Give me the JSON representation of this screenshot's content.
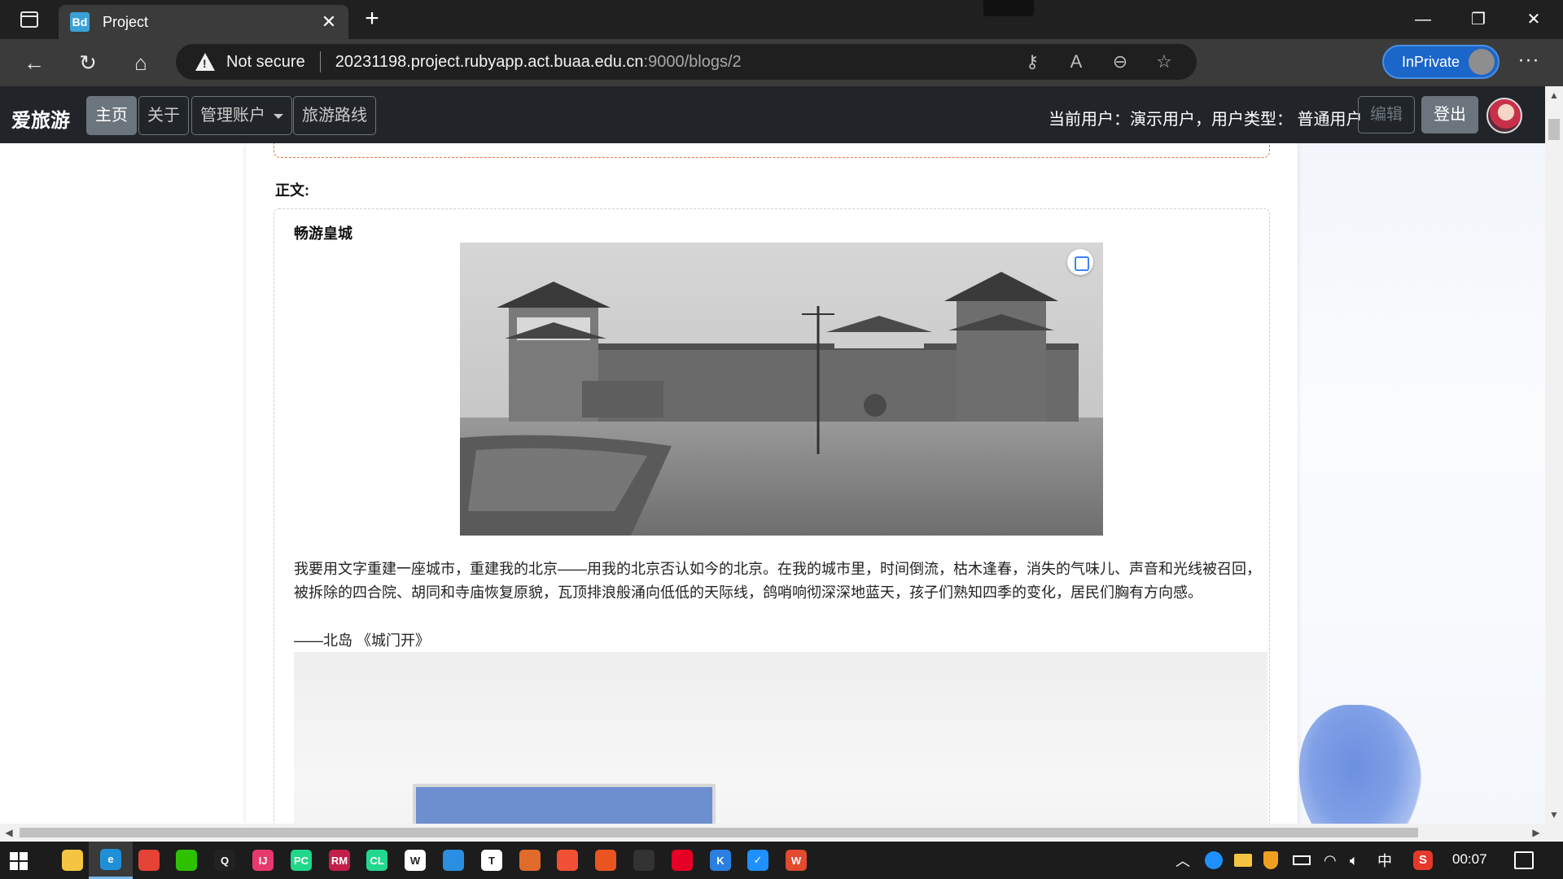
{
  "browser": {
    "tab_title": "Project",
    "tab_favicon_text": "Bd",
    "security_label": "Not secure",
    "url_host": "20231198.project.rubyapp.act.buaa.edu.cn",
    "url_rest": ":9000/blogs/2",
    "inprivate_label": "InPrivate",
    "address_icons": [
      "key-icon",
      "read-aloud-icon",
      "zoom-out-icon",
      "favorite-add-icon"
    ]
  },
  "site_nav": {
    "brand": "爱旅游",
    "items": [
      {
        "label": "主页",
        "active": true
      },
      {
        "label": "关于",
        "active": false
      },
      {
        "label": "管理账户",
        "active": false,
        "dropdown": true
      },
      {
        "label": "旅游路线",
        "active": false
      }
    ],
    "current_user_text": "当前用户：演示用户，用户类型：  普通用户",
    "edit_label": "编辑",
    "logout_label": "登出"
  },
  "post": {
    "body_label": "正文:",
    "title": "畅游皇城",
    "quote": "我要用文字重建一座城市，重建我的北京——用我的北京否认如今的北京。在我的城市里，时间倒流，枯木逢春，消失的气味儿、声音和光线被召回，被拆除的四合院、胡同和寺庙恢复原貌，瓦顶排浪般涌向低低的天际线，鸽哨响彻深深地蓝天，孩子们熟知四季的变化，居民们胸有方向感。",
    "quote_author": "——北岛 《城门开》"
  },
  "taskbar": {
    "apps": [
      {
        "name": "file-explorer-icon",
        "glyph": "",
        "color": "#f5c542"
      },
      {
        "name": "edge-icon",
        "glyph": "e",
        "color": "#1f8fd8",
        "active": true
      },
      {
        "name": "chrome-icon",
        "glyph": "",
        "color": "#e54335"
      },
      {
        "name": "wechat-icon",
        "glyph": "",
        "color": "#2dc100"
      },
      {
        "name": "qq-icon",
        "glyph": "Q",
        "color": "#222222"
      },
      {
        "name": "intellij-icon",
        "glyph": "IJ",
        "color": "#e8396e"
      },
      {
        "name": "pycharm-icon",
        "glyph": "PC",
        "color": "#21d789"
      },
      {
        "name": "rubymine-icon",
        "glyph": "RM",
        "color": "#c21f4a"
      },
      {
        "name": "clion-icon",
        "glyph": "CL",
        "color": "#22d88f"
      },
      {
        "name": "word-icon",
        "glyph": "W",
        "color": "#ffffff"
      },
      {
        "name": "vscode-icon",
        "glyph": "",
        "color": "#2a8fe0"
      },
      {
        "name": "typora-icon",
        "glyph": "T",
        "color": "#ffffff"
      },
      {
        "name": "matlab-icon",
        "glyph": "",
        "color": "#e06b2a"
      },
      {
        "name": "git-icon",
        "glyph": "",
        "color": "#f05033"
      },
      {
        "name": "ubuntu-icon",
        "glyph": "",
        "color": "#e95420"
      },
      {
        "name": "terminal-icon",
        "glyph": "",
        "color": "#333333"
      },
      {
        "name": "netease-music-icon",
        "glyph": "",
        "color": "#e60026"
      },
      {
        "name": "kugou-icon",
        "glyph": "K",
        "color": "#2a7fe0"
      },
      {
        "name": "check-app-icon",
        "glyph": "✓",
        "color": "#1e90ff"
      },
      {
        "name": "wps-icon",
        "glyph": "W",
        "color": "#e34a2f"
      }
    ],
    "ime_label": "中",
    "time": "00:07"
  }
}
